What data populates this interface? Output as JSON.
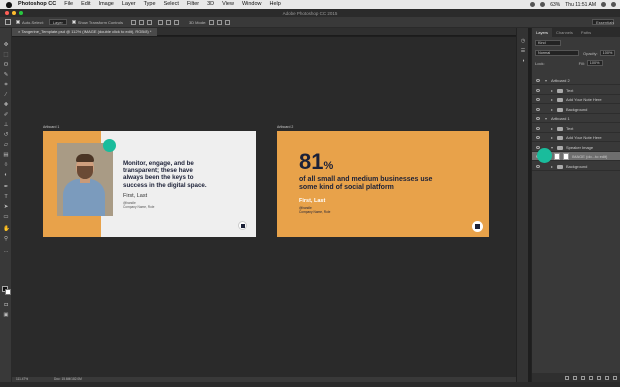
{
  "menubar": {
    "app": "Photoshop CC",
    "items": [
      "File",
      "Edit",
      "Image",
      "Layer",
      "Type",
      "Select",
      "Filter",
      "3D",
      "View",
      "Window",
      "Help"
    ],
    "battery": "63%",
    "time": "Thu 11:51 AM"
  },
  "window": {
    "title": "Adobe Photoshop CC 2015"
  },
  "options": {
    "auto_select": "Auto-Select:",
    "auto_select_value": "Layer",
    "show_transform": "Show Transform Controls",
    "mode_3d": "3D Mode:",
    "workspace": "Essentials"
  },
  "document": {
    "tab": "Tangerine_Template.psd @ 112% (IMAGE (double click to edit), RGB/8) *",
    "zoom": "111.47%",
    "doc_size": "Doc: 15.6M/182.0M"
  },
  "artboards": [
    {
      "label": "Artboard 1",
      "quote": "Monitor, engage, and be\ntransparent; these have\nalways been the keys to\nsuccess in the digital space.",
      "name": "First, Last",
      "handle": "@handle",
      "company": "Company Name, Role"
    },
    {
      "label": "Artboard 2",
      "stat_number": "81",
      "stat_unit": "%",
      "stat_text": "of all small and medium businesses use\nsome kind of social platform",
      "name": "First, Last",
      "handle": "@handle",
      "company": "Company Name, Role"
    }
  ],
  "panel": {
    "tabs": [
      "Layers",
      "Channels",
      "Paths"
    ],
    "kind": "Kind",
    "blend": "Normal",
    "opacity_label": "Opacity:",
    "opacity": "100%",
    "lock_label": "Lock:",
    "fill_label": "Fill:",
    "fill": "100%",
    "layers": [
      {
        "name": "Artboard 2",
        "indent": 0,
        "type": "artboard"
      },
      {
        "name": "Text",
        "indent": 1,
        "type": "folder"
      },
      {
        "name": "Add Your Note Here",
        "indent": 1,
        "type": "folder"
      },
      {
        "name": "Background",
        "indent": 1,
        "type": "folder"
      },
      {
        "name": "Artboard 1",
        "indent": 0,
        "type": "artboard"
      },
      {
        "name": "Text",
        "indent": 1,
        "type": "folder"
      },
      {
        "name": "Add Your Note Here",
        "indent": 1,
        "type": "folder"
      },
      {
        "name": "Speaker Image",
        "indent": 1,
        "type": "folder-open"
      },
      {
        "name": "IMAGE (do...to edit)",
        "indent": 2,
        "type": "layer",
        "selected": true
      },
      {
        "name": "Background",
        "indent": 1,
        "type": "folder"
      }
    ]
  },
  "colors": {
    "accent": "#e8a24a",
    "teal": "#1abc9c",
    "navy": "#1c2138"
  }
}
